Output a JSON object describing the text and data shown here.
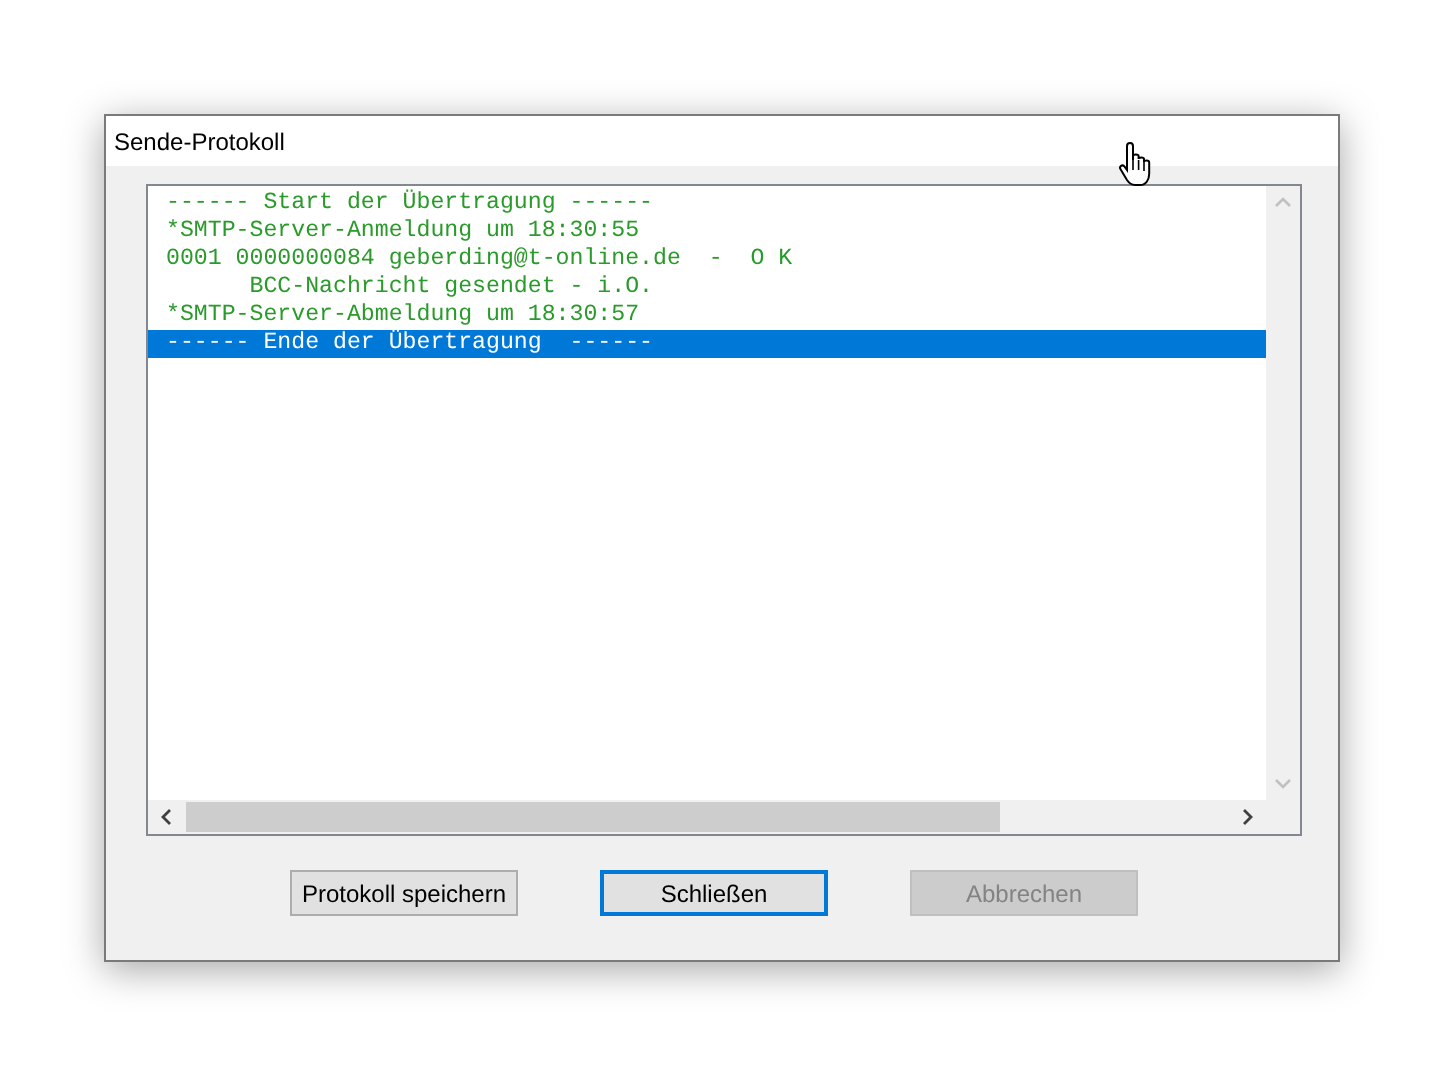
{
  "window": {
    "title": "Sende-Protokoll"
  },
  "log": [
    {
      "text": "------ Start der Übertragung ------",
      "selected": false
    },
    {
      "text": "*SMTP-Server-Anmeldung um 18:30:55",
      "selected": false
    },
    {
      "text": "0001 0000000084 geberding@t-online.de  -  O K",
      "selected": false
    },
    {
      "text": "      BCC-Nachricht gesendet - i.O.",
      "selected": false
    },
    {
      "text": "*SMTP-Server-Abmeldung um 18:30:57",
      "selected": false
    },
    {
      "text": "------ Ende der Übertragung  ------",
      "selected": true
    }
  ],
  "buttons": [
    {
      "label": "Protokoll speichern",
      "default": false,
      "disabled": false
    },
    {
      "label": "Schließen",
      "default": true,
      "disabled": false
    },
    {
      "label": "Abbrechen",
      "default": false,
      "disabled": true
    }
  ]
}
